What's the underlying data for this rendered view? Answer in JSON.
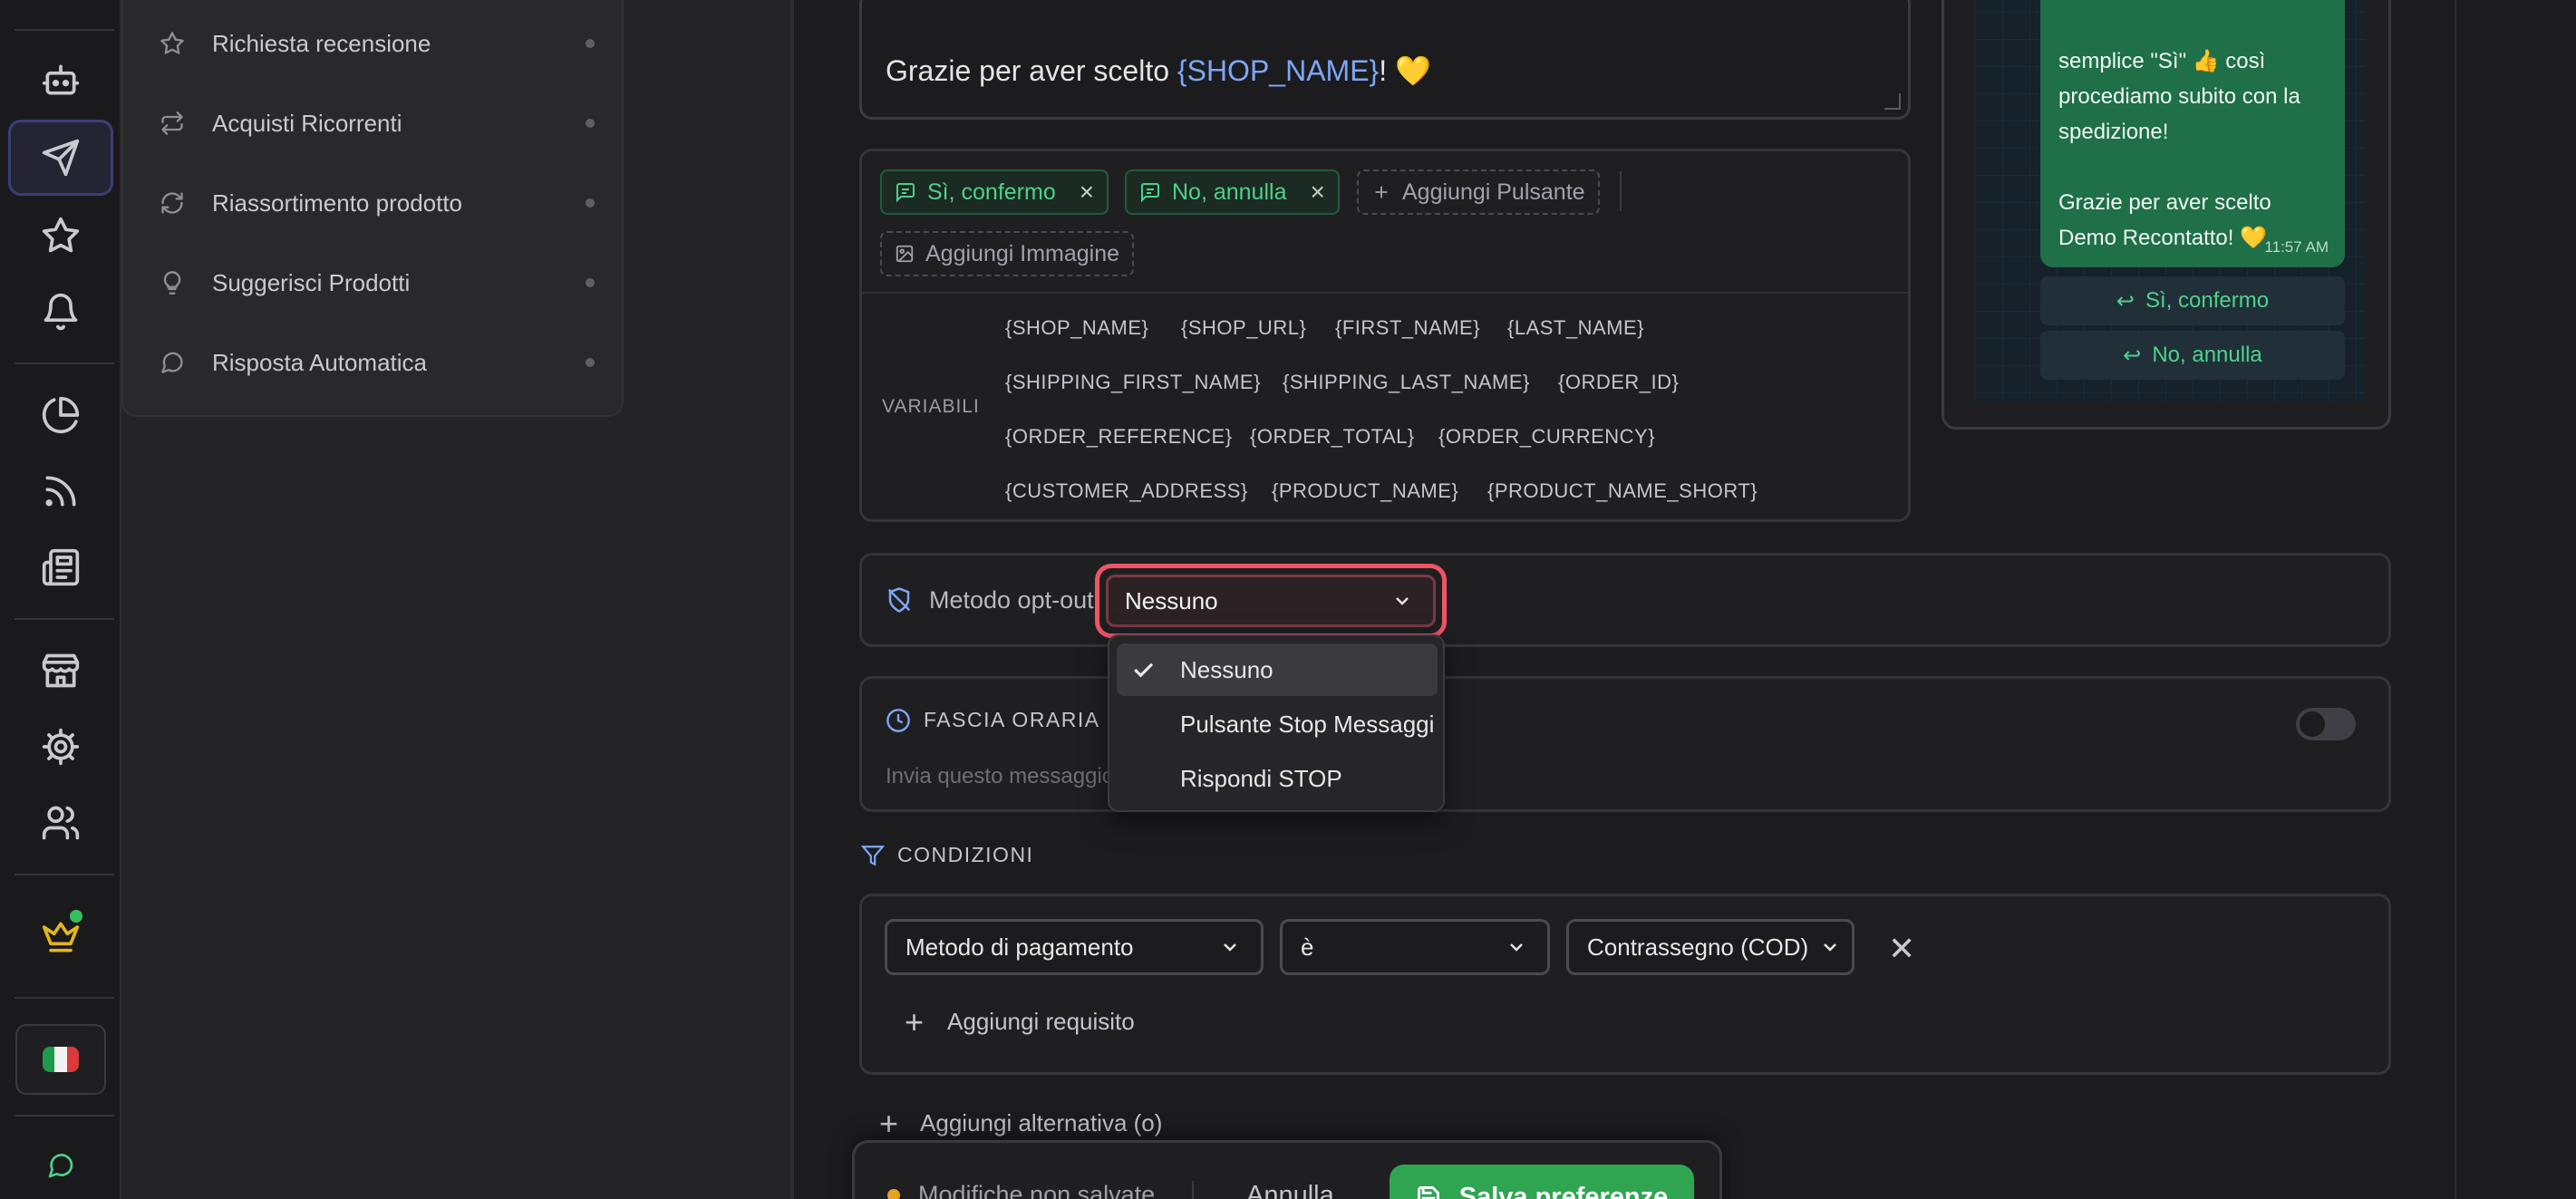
{
  "nav": {
    "rail_icons": [
      "bot-icon",
      "send-icon",
      "star-icon",
      "bell-icon",
      "pie-chart-icon",
      "rss-icon",
      "newspaper-icon",
      "store-icon",
      "settings-icon",
      "users-icon",
      "crown-icon",
      "chat-icon"
    ],
    "active_icon": "send-icon",
    "language_flag": "italy-flag"
  },
  "subnav": {
    "items": [
      {
        "label": "Richiesta recensione",
        "icon": "star-icon"
      },
      {
        "label": "Acquisti Ricorrenti",
        "icon": "repeat-icon"
      },
      {
        "label": "Riassortimento prodotto",
        "icon": "refresh-icon"
      },
      {
        "label": "Suggerisci Prodotti",
        "icon": "lightbulb-icon"
      },
      {
        "label": "Risposta Automatica",
        "icon": "message-icon"
      }
    ]
  },
  "message": {
    "text_before": "Grazie per aver scelto ",
    "variable": "{SHOP_NAME}",
    "text_after": "! 💛"
  },
  "buttons": {
    "reply_1": "Sì, confermo",
    "reply_2": "No, annulla",
    "add_button": "Aggiungi Pulsante",
    "add_image": "Aggiungi Immagine"
  },
  "variables": {
    "label": "VARIABILI",
    "rows": [
      [
        "{SHOP_NAME}",
        "{SHOP_URL}",
        "{FIRST_NAME}",
        "{LAST_NAME}"
      ],
      [
        "{SHIPPING_FIRST_NAME}",
        "{SHIPPING_LAST_NAME}",
        "{ORDER_ID}"
      ],
      [
        "{ORDER_REFERENCE}",
        "{ORDER_TOTAL}",
        "{ORDER_CURRENCY}"
      ],
      [
        "{CUSTOMER_ADDRESS}",
        "{PRODUCT_NAME}",
        "{PRODUCT_NAME_SHORT}"
      ]
    ]
  },
  "preview": {
    "bubble_text": "semplice \"Sì\" 👍 così\nprocediamo subito con la\nspedizione!\n\nGrazie per aver scelto\nDemo Recontatto! 💛",
    "time": "11:57 AM",
    "reply_1": "Sì, confermo",
    "reply_2": "No, annulla"
  },
  "optout": {
    "label": "Metodo opt-out",
    "selected": "Nessuno",
    "options": [
      "Nessuno",
      "Pulsante Stop Messaggi",
      "Rispondi STOP"
    ]
  },
  "time_window": {
    "title": "FASCIA ORARIA D",
    "description": "Invia questo messaggio",
    "enabled": false
  },
  "conditions": {
    "title": "CONDIZIONI",
    "field": "Metodo di pagamento",
    "operator": "è",
    "value": "Contrassegno (COD)",
    "add_requirement": "Aggiungi requisito",
    "add_alternative": "Aggiungi alternativa (o)"
  },
  "savebar": {
    "status": "Modifiche non salvate",
    "cancel": "Annulla",
    "save": "Salva preferenze"
  },
  "colors": {
    "accent_blue": "#7ea7f5",
    "green": "#2fa552",
    "focus_ring": "#f05468",
    "warning_dot": "#e4a322"
  }
}
